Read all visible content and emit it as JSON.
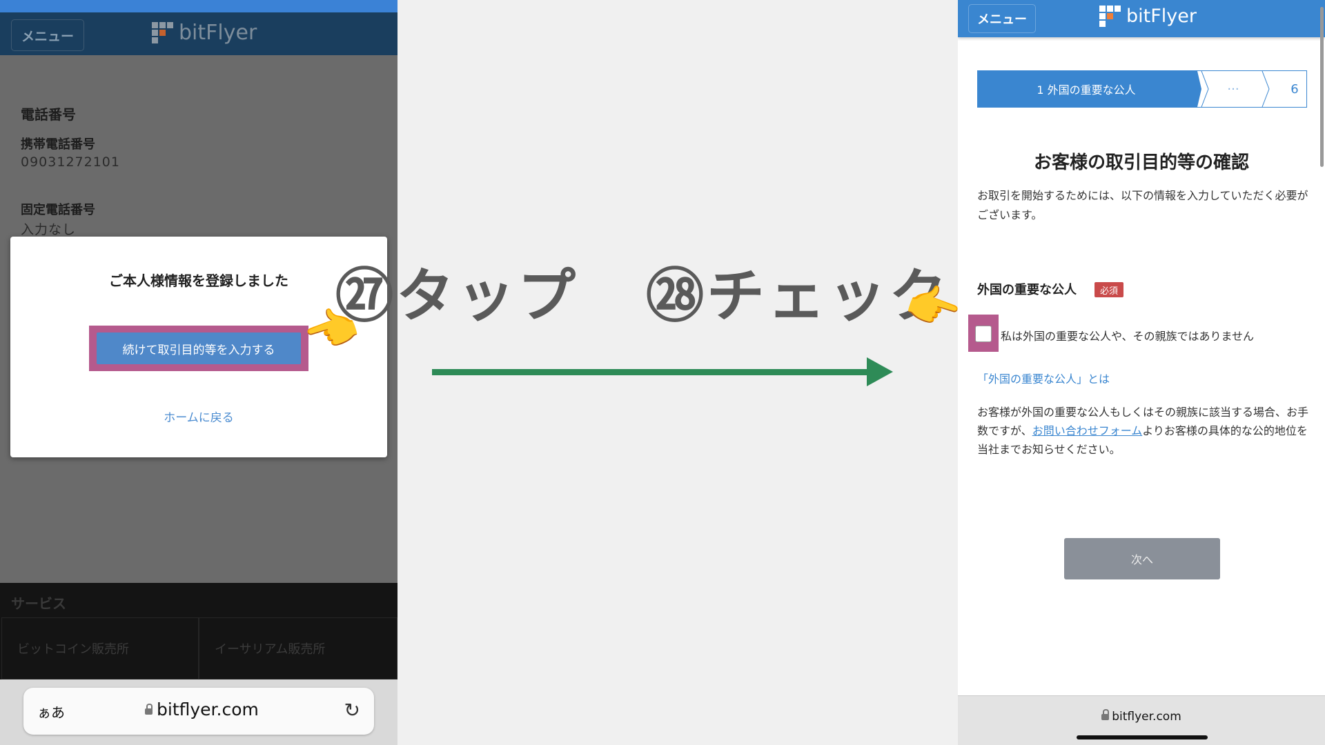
{
  "left_phone": {
    "menu_label": "メニュー",
    "logo_text": "bitFlyer",
    "section_title": "電話番号",
    "mobile_label": "携帯電話番号",
    "mobile_value": "09031272101",
    "landline_label": "固定電話番号",
    "landline_value": "入力なし",
    "modal": {
      "title": "ご本人様情報を登録しました",
      "primary_button": "続けて取引目的等を入力する",
      "secondary_link": "ホームに戻る"
    },
    "services": {
      "title": "サービス",
      "items": [
        "ビットコイン販売所",
        "イーサリアム販売所"
      ]
    },
    "browser": {
      "aa": "ぁあ",
      "url": "bitflyer.com"
    }
  },
  "steps": {
    "step27": "㉗タップ",
    "step28": "㉘チェック"
  },
  "right_phone": {
    "menu_label": "メニュー",
    "logo_text": "bitFlyer",
    "stepper": {
      "active": "1 外国の重要な公人",
      "dots": "···",
      "last": "6"
    },
    "title": "お客様の取引目的等の確認",
    "description": "お取引を開始するためには、以下の情報を入力していただく必要がございます。",
    "field_label": "外国の重要な公人",
    "required_badge": "必須",
    "checkbox_label": "私は外国の重要な公人や、その親族ではありません",
    "info_link": "「外国の重要な公人」とは",
    "note_before": "お客様が外国の重要な公人もしくはその親族に該当する場合、お手数ですが、",
    "note_link": "お問い合わせフォーム",
    "note_after": "よりお客様の具体的な公的地位を当社までお知らせください。",
    "next_button": "次へ",
    "browser_url": "bitflyer.com"
  },
  "colors": {
    "brand_blue": "#3a86d0",
    "highlight_pink": "#b55a8d",
    "arrow_green": "#2e8b57",
    "required_red": "#c94a4a"
  }
}
